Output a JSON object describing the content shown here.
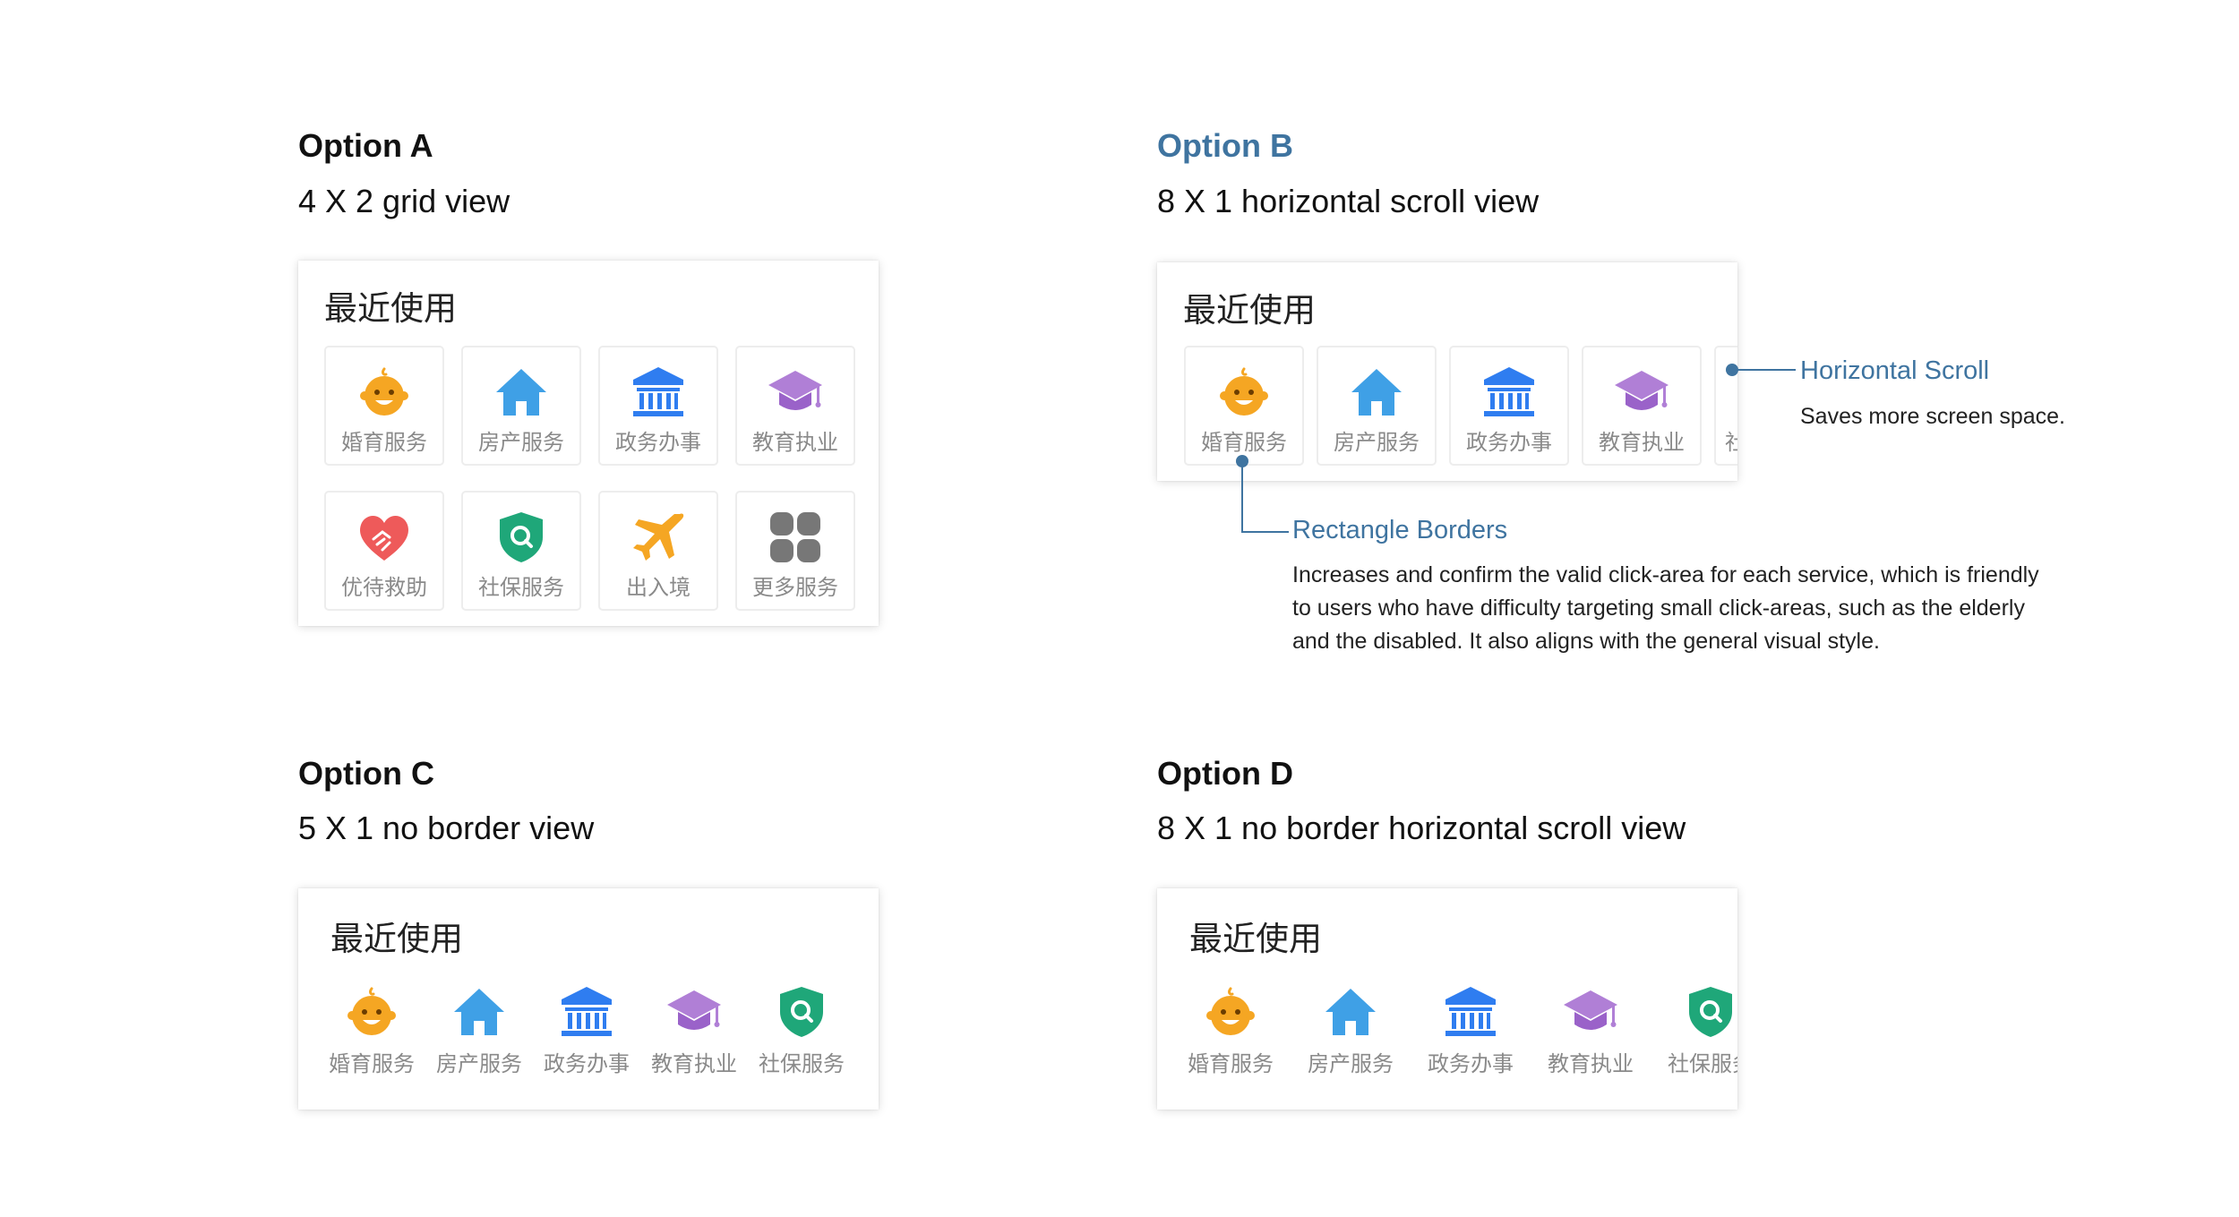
{
  "card_heading": "最近使用",
  "services": {
    "marriage": "婚育服务",
    "housing": "房产服务",
    "government": "政务办事",
    "education": "教育执业",
    "assistance": "优待救助",
    "social": "社保服务",
    "travel": "出入境",
    "more": "更多服务",
    "partial_clipped_b": "社",
    "partial_clipped_d": "社保服务"
  },
  "options": {
    "a": {
      "title": "Option A",
      "subtitle": "4 X 2 grid view"
    },
    "b": {
      "title": "Option B",
      "subtitle": "8 X 1 horizontal scroll view"
    },
    "c": {
      "title": "Option C",
      "subtitle": "5 X 1 no border view"
    },
    "d": {
      "title": "Option D",
      "subtitle": "8 X 1 no border horizontal scroll view"
    }
  },
  "annotations": {
    "scroll": {
      "title": "Horizontal Scroll",
      "body": "Saves more screen space."
    },
    "borders": {
      "title": "Rectangle Borders",
      "lines": [
        "Increases and confirm the valid click-area for each service, which is friendly",
        "to users who have difficulty targeting small click-areas, such as the elderly",
        "and the disabled. It also aligns with the general visual style."
      ]
    }
  },
  "colors": {
    "accent": "#3f74a0",
    "marriage_icon": "#f5a623",
    "housing_icon": "#3fa0e6",
    "government_icon": "#2f7df0",
    "education_icon": "#b07fd6",
    "assistance_icon": "#ee5a5a",
    "social_icon": "#1fa779",
    "travel_icon": "#f5a623",
    "more_icon": "#777777"
  }
}
